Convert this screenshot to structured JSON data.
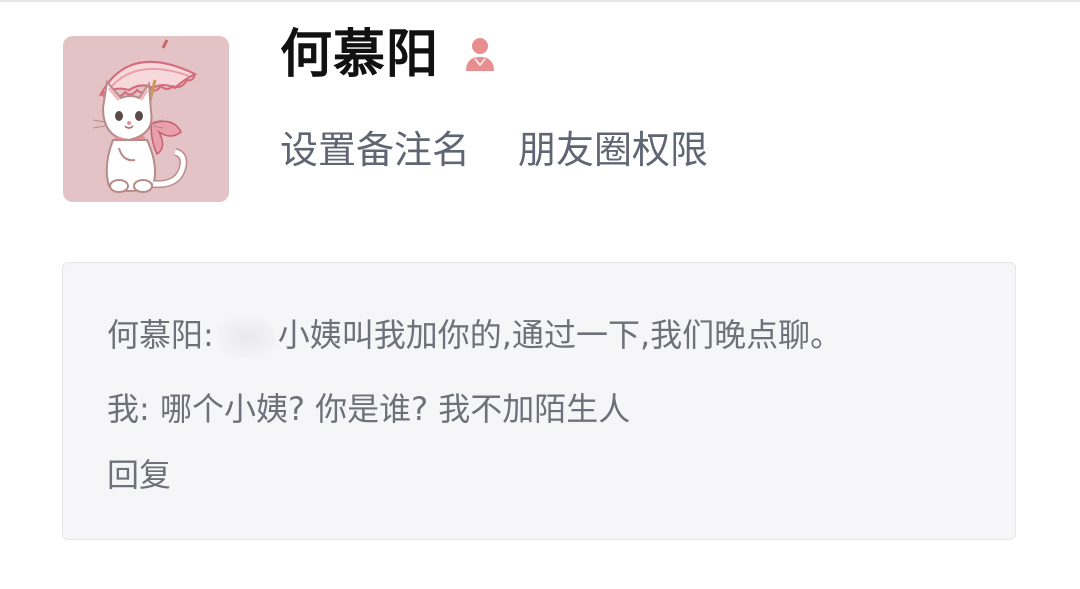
{
  "profile": {
    "name": "何慕阳",
    "gender_icon": "female-person-icon",
    "avatar_icon": "cat-with-umbrella-avatar",
    "accent_color": "#e88e8e"
  },
  "actions": {
    "set_remark": "设置备注名",
    "moments_permission": "朋友圈权限"
  },
  "messages": [
    {
      "sender": "何慕阳:",
      "text": "小姨叫我加你的,通过一下,我们晚点聊。",
      "redacted": true
    },
    {
      "sender": "我:",
      "text": "哪个小姨? 你是谁? 我不加陌生人"
    }
  ],
  "reply_label": "回复",
  "colors": {
    "name": "#111111",
    "action_text": "#5f6573",
    "message_text": "#6e717a",
    "card_background": "#f6f6f8",
    "avatar_background": "#e3c3c5"
  }
}
